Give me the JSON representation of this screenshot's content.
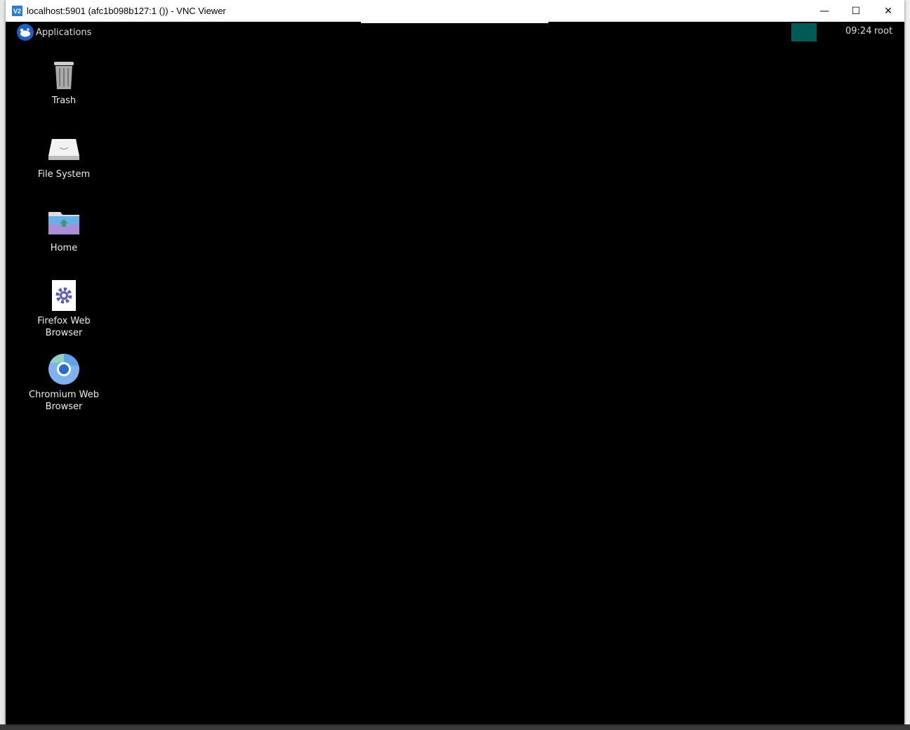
{
  "window": {
    "title": "localhost:5901 (afc1b098b127:1 ()) - VNC Viewer",
    "app_icon_text": "V2"
  },
  "controls": {
    "minimize": "—",
    "maximize": "☐",
    "close": "✕"
  },
  "panel": {
    "applications_label": "Applications",
    "clock": "09:24",
    "user": "root",
    "workspace_color": "#005a55"
  },
  "desktop_icons": [
    {
      "label": "Trash",
      "icon": "trash-icon"
    },
    {
      "label": "File System",
      "icon": "drive-icon"
    },
    {
      "label": "Home",
      "icon": "home-folder-icon"
    },
    {
      "label": "Firefox Web Browser",
      "icon": "gear-icon"
    },
    {
      "label": "Chromium Web Browser",
      "icon": "chromium-icon"
    }
  ]
}
